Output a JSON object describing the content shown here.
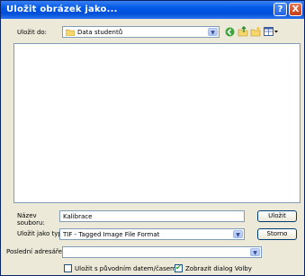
{
  "window": {
    "title": "Uložit obrázek jako..."
  },
  "title_buttons": {
    "help": "?",
    "close": "X"
  },
  "location": {
    "label": "Uložit do:",
    "value": "Data studentů"
  },
  "toolbar_icons": [
    "back-icon",
    "up-folder-icon",
    "new-folder-icon",
    "view-menu-icon"
  ],
  "filename": {
    "label_line1": "Název",
    "label_line2": "souboru:",
    "value": "Kalibrace"
  },
  "filetype": {
    "label": "Uložit jako typ:",
    "value": "TIF - Tagged Image File Format"
  },
  "recent": {
    "label": "Poslední adresáře",
    "value": ""
  },
  "buttons": {
    "save": "Uložit",
    "cancel": "Storno"
  },
  "options": {
    "keep_date": {
      "label": "Uložit s původním datem/časem",
      "checked": false
    },
    "show_dialog": {
      "label": "Zobrazit dialog Volby",
      "checked": true
    }
  }
}
